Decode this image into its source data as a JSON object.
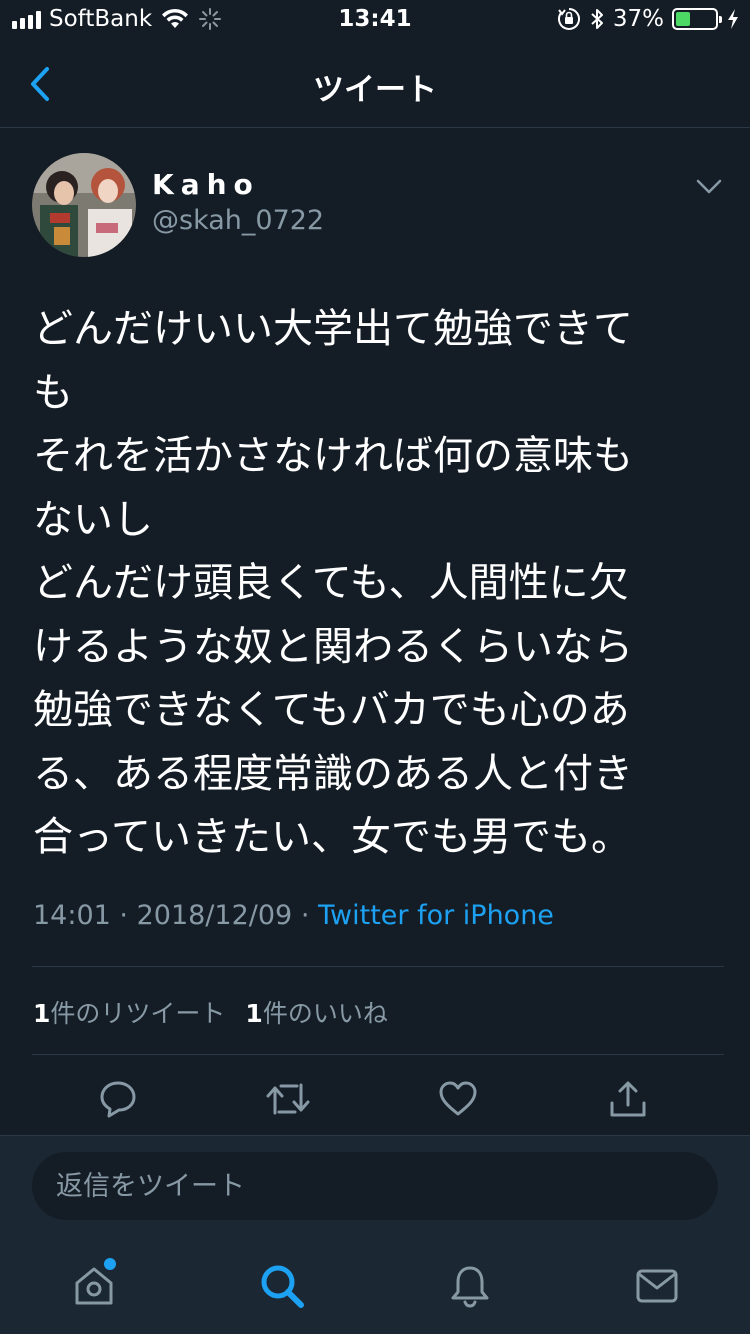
{
  "status_bar": {
    "carrier": "SoftBank",
    "time": "13:41",
    "battery_percent": "37%",
    "battery_level": 0.37
  },
  "nav": {
    "title": "ツイート",
    "back_icon": "chevron-left-icon"
  },
  "tweet": {
    "display_name": "Kaho",
    "handle": "@skah_0722",
    "text_lines": [
      "どんだけいい大学出て勉強できて",
      "も",
      "それを活かさなければ何の意味も",
      "ないし",
      "どんだけ頭良くても、人間性に欠",
      "けるような奴と関わるくらいなら",
      "勉強できなくてもバカでも心のあ",
      "る、ある程度常識のある人と付き",
      "合っていきたい、女でも男でも。"
    ],
    "time": "14:01",
    "date": "2018/12/09",
    "separator": "·",
    "source": "Twitter for iPhone",
    "retweet_count": "1",
    "retweet_label": "件のリツイート",
    "like_count": "1",
    "like_label": "件のいいね"
  },
  "reply": {
    "placeholder": "返信をツイート"
  },
  "colors": {
    "background": "#141d26",
    "bar_background": "#1b2733",
    "accent": "#1da1f2",
    "secondary_text": "#8899a6",
    "divider": "#2a3744"
  },
  "tab_bar": {
    "tabs": [
      "home-icon",
      "search-icon",
      "notifications-icon",
      "messages-icon"
    ],
    "active": "search-icon"
  }
}
